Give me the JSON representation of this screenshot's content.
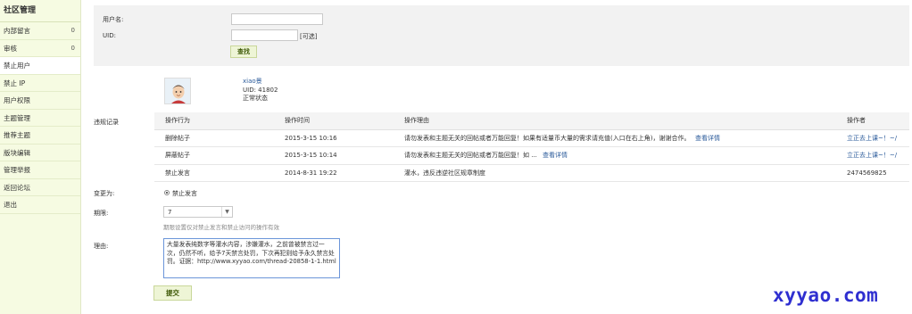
{
  "sidebar": {
    "title": "社区管理",
    "items": [
      {
        "label": "内部留言",
        "count": "0"
      },
      {
        "label": "审核",
        "count": "0"
      },
      {
        "label": "禁止用户",
        "count": ""
      },
      {
        "label": "禁止 IP",
        "count": ""
      },
      {
        "label": "用户权限",
        "count": ""
      },
      {
        "label": "主题管理",
        "count": ""
      },
      {
        "label": "推荐主题",
        "count": ""
      },
      {
        "label": "版块编辑",
        "count": ""
      },
      {
        "label": "管理举报",
        "count": ""
      },
      {
        "label": "返回论坛",
        "count": ""
      },
      {
        "label": "退出",
        "count": ""
      }
    ],
    "active_index": 2
  },
  "search": {
    "username_label": "用户名:",
    "username_value": "",
    "uid_label": "UID:",
    "uid_value": "",
    "uid_optional": "[可选]",
    "search_button": "查找"
  },
  "user": {
    "name": "xiao景",
    "uid": "UID: 41802",
    "status": "正常状态"
  },
  "records": {
    "section_label": "违规记录",
    "headers": [
      "操作行为",
      "操作时间",
      "操作理由",
      "操作者"
    ],
    "rows": [
      {
        "action": "删除帖子",
        "time": "2015-3-15 10:16",
        "reason": "请勿发表和主题无关的回帖或者万能回复！如果有适量币大量的需求请充值(入口在右上角)，谢谢合作。",
        "detail": "查看详情",
        "operator": "立正去上课~！~/"
      },
      {
        "action": "屏蔽帖子",
        "time": "2015-3-15 10:14",
        "reason": "请勿发表和主题无关的回帖或者万能回复！如 ...",
        "detail": "查看详情",
        "operator": "立正去上课~！~/"
      },
      {
        "action": "禁止发言",
        "time": "2014-8-31 19:22",
        "reason": "灌水，违反违逆社区规章制度",
        "detail": "",
        "operator": "2474569825"
      }
    ]
  },
  "form": {
    "change_label": "变更为:",
    "change_option": "禁止发言",
    "period_label": "期限:",
    "period_value": "7",
    "period_hint": "期限设置仅对禁止发言和禁止访问的操作有效",
    "reason_label": "理由:",
    "reason_text": "大量发表纯数字等灌水内容，涉嫌灌水，之前曾被禁言过一次，仍然不听，给予7天禁言处罚，下次再犯则给予永久禁言处罚。证据：http://www.xyyao.com/thread-20858-1-1.html",
    "submit_button": "提交"
  },
  "watermark": "xyyao.com"
}
